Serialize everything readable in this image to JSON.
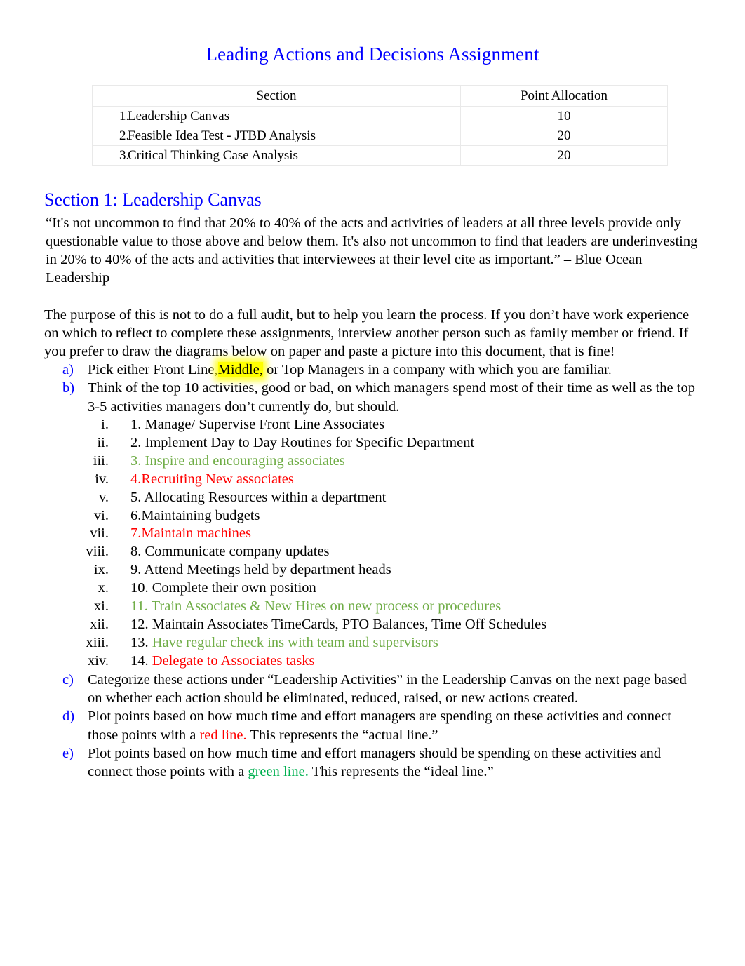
{
  "document": {
    "title": "Leading Actions and Decisions Assignment",
    "title_color": "#0000FF"
  },
  "points_table": {
    "headers": {
      "section": "Section",
      "points": "Point Allocation"
    },
    "rows": [
      {
        "num": "1.",
        "section": "Leadership Canvas",
        "points": "10"
      },
      {
        "num": "2.",
        "section": "Feasible Idea Test - JTBD Analysis",
        "points": "20"
      },
      {
        "num": "3.",
        "section": "Critical Thinking Case Analysis",
        "points": "20"
      }
    ]
  },
  "section1": {
    "heading": "Section 1: Leadership Canvas",
    "quote": "“It's not uncommon to find that 20% to 40% of the acts and activities of leaders at all three levels provide only questionable value to those above and below them. It's also not uncommon to find that leaders are underinvesting in 20% to 40% of the acts and activities that interviewees at their level cite as important.” – Blue Ocean Leadership",
    "purpose_paragraph": "The purpose of this is not to do a full audit, but to help you learn the process. If you don’t have work experience on which to reflect to complete these assignments, interview another person such as family member or friend. If you prefer to draw the diagrams below on paper and paste a picture into this document, that is fine!",
    "instructions": {
      "a": {
        "marker": "a)",
        "text_part1": "Pick either Front Line,",
        "highlight": "Middle,",
        "text_part2": " or Top Managers in a company with which you are familiar."
      },
      "b": {
        "marker": "b)",
        "text": "Think of the top 10 activities, good or bad, on which managers spend most of their time as well as the top 3-5 activities managers don’t currently do, but should."
      },
      "c": {
        "marker": "c)",
        "text": "Categorize these actions under “Leadership Activities” in the Leadership Canvas on the next page based on whether each action should be eliminated, reduced, raised, or new actions created."
      },
      "d": {
        "marker": "d)",
        "text_part1": "Plot points based on how much time and effort managers   are spending on these activities and connect those points with a  ",
        "colored": "red line.",
        "colored_color": "#FF0000",
        "text_part2": " This represents the “actual line.”"
      },
      "e": {
        "marker": "e)",
        "text_part1": "Plot points based on how much time and effort managers   should be spending on these activities and connect those points with a  ",
        "colored": "green line.",
        "colored_color": "#00B050",
        "text_part2": " This represents the “ideal line.”"
      }
    },
    "activities": [
      {
        "marker": "i.",
        "number": "1.",
        "text": " Manage/ Supervise Front Line Associates",
        "color": "#000000",
        "number_color": "#000000"
      },
      {
        "marker": "ii.",
        "number": "2.",
        "text": " Implement Day to Day Routines for Specific Department",
        "color": "#000000",
        "number_color": "#000000"
      },
      {
        "marker": "iii.",
        "number": "3.",
        "text": " Inspire and encouraging associates",
        "color": "#70AD47",
        "number_color": "#70AD47"
      },
      {
        "marker": "iv.",
        "number": "4.",
        "text": "Recruiting New associates",
        "color": "#FF0000",
        "number_color": "#FF0000"
      },
      {
        "marker": "v.",
        "number": "5.",
        "text": " Allocating Resources within a department",
        "color": "#000000",
        "number_color": "#000000"
      },
      {
        "marker": "vi.",
        "number": "6.",
        "text": "Maintaining budgets",
        "color": "#000000",
        "number_color": "#000000"
      },
      {
        "marker": "vii.",
        "number": "7.",
        "text": "Maintain machines",
        "color": "#FF0000",
        "number_color": "#FF0000"
      },
      {
        "marker": "viii.",
        "number": "8.",
        "text": " Communicate company updates",
        "color": "#000000",
        "number_color": "#000000"
      },
      {
        "marker": "ix.",
        "number": "9.",
        "text": " Attend Meetings held by department heads",
        "color": "#000000",
        "number_color": "#000000"
      },
      {
        "marker": "x.",
        "number": "10.",
        "text": " Complete their own position",
        "color": "#000000",
        "number_color": "#000000"
      },
      {
        "marker": "xi.",
        "number": "11.",
        "text": " Train Associates & New Hires on new process or procedures",
        "color": "#70AD47",
        "number_color": "#70AD47"
      },
      {
        "marker": "xii.",
        "number": "12.",
        "text": " Maintain Associates TimeCards, PTO Balances, Time Off Schedules",
        "color": "#000000",
        "number_color": "#000000"
      },
      {
        "marker": "xiii.",
        "number": "13.",
        "text": " Have regular check ins with team and supervisors",
        "color": "#70AD47",
        "number_color": "#000000"
      },
      {
        "marker": "xiv.",
        "number": "14.",
        "text": "  Delegate to Associates tasks",
        "color": "#FF0000",
        "number_color": "#000000"
      }
    ]
  }
}
